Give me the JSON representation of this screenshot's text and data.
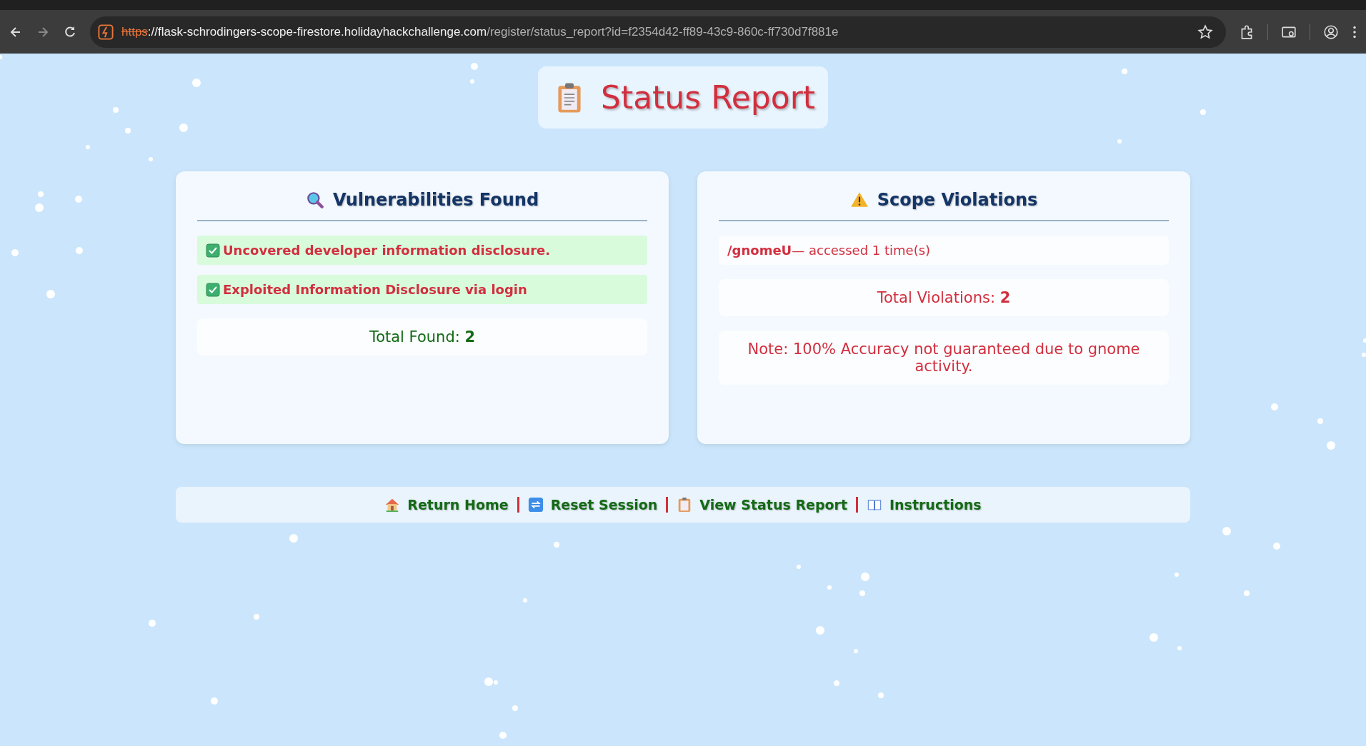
{
  "browser": {
    "url_scheme": "https",
    "url_host": "://flask-schrodingers-scope-firestore.holidayhackchallenge.com",
    "url_path": "/register/status_report?id=f2354d42-ff89-43c9-860c-ff730d7f881e",
    "bookmarked": false
  },
  "title": "Status Report",
  "vulnerabilities": {
    "heading": "Vulnerabilities Found",
    "items": [
      {
        "text": "Uncovered developer information disclosure.",
        "checked": true
      },
      {
        "text": "Exploited Information Disclosure via login",
        "checked": true
      }
    ],
    "total": "Total Found: **2**"
  },
  "violations": {
    "heading": "Scope Violations",
    "items": [
      "**/gnomeU**— accessed 1 time(s)"
    ],
    "total": "Total Violations: **2**",
    "note": "Note: 100% Accuracy not guaranteed due to gnome activity."
  },
  "nav": [
    {
      "kind": "home",
      "label": "Return Home"
    },
    {
      "kind": "reset",
      "label": "Reset Session"
    },
    {
      "kind": "report",
      "label": "View Status Report"
    },
    {
      "kind": "book",
      "label": "Instructions"
    }
  ]
}
